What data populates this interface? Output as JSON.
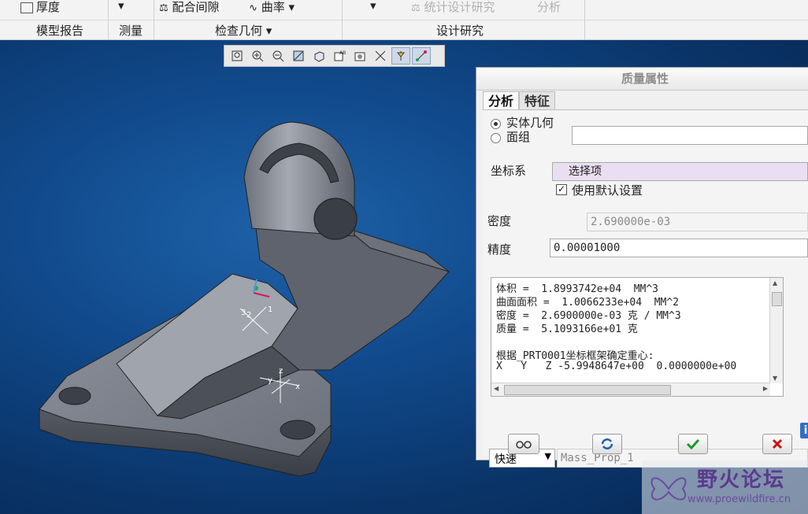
{
  "ribbon": {
    "row1": {
      "thickness": "厚度",
      "clearance": "配合间隙",
      "curvature": "曲率",
      "stat_study": "统计设计研究",
      "analysis": "分析"
    },
    "groups": {
      "model_report": "模型报告",
      "measure": "测量",
      "inspect_geometry": "检查几何",
      "design_study": "设计研究"
    }
  },
  "viewport": {
    "csys_labels": [
      "3",
      "2",
      "1"
    ],
    "axis_labels": [
      "z",
      "y",
      "x"
    ]
  },
  "dialog": {
    "title": "质量属性",
    "tabs": [
      "分析",
      "特征"
    ],
    "solid_geometry": "实体几何",
    "quilt": "面组",
    "csys_label": "坐标系",
    "csys_value": "选择项",
    "use_default": "使用默认设置",
    "density_label": "密度",
    "density_value": "2.690000e-03",
    "accuracy_label": "精度",
    "accuracy_value": "0.00001000",
    "results": [
      "体积 =  1.8993742e+04  MM^3",
      "曲面面积 =  1.0066233e+04  MM^2",
      "密度 =  2.6900000e-03 克 / MM^3",
      "质量 =  5.1093166e+01 克",
      "",
      "根据_PRT0001坐标框架确定重心:",
      "X   Y   Z -5.9948647e+00  0.0000000e+00"
    ],
    "mode_value": "快速",
    "name_value": "Mass_Prop_1"
  },
  "watermark": {
    "title": "野火论坛",
    "url": "www.proewildfire.cn"
  },
  "colors": {
    "ok": "#1a9a2a",
    "cancel": "#c81414",
    "background": "#114a8c"
  }
}
